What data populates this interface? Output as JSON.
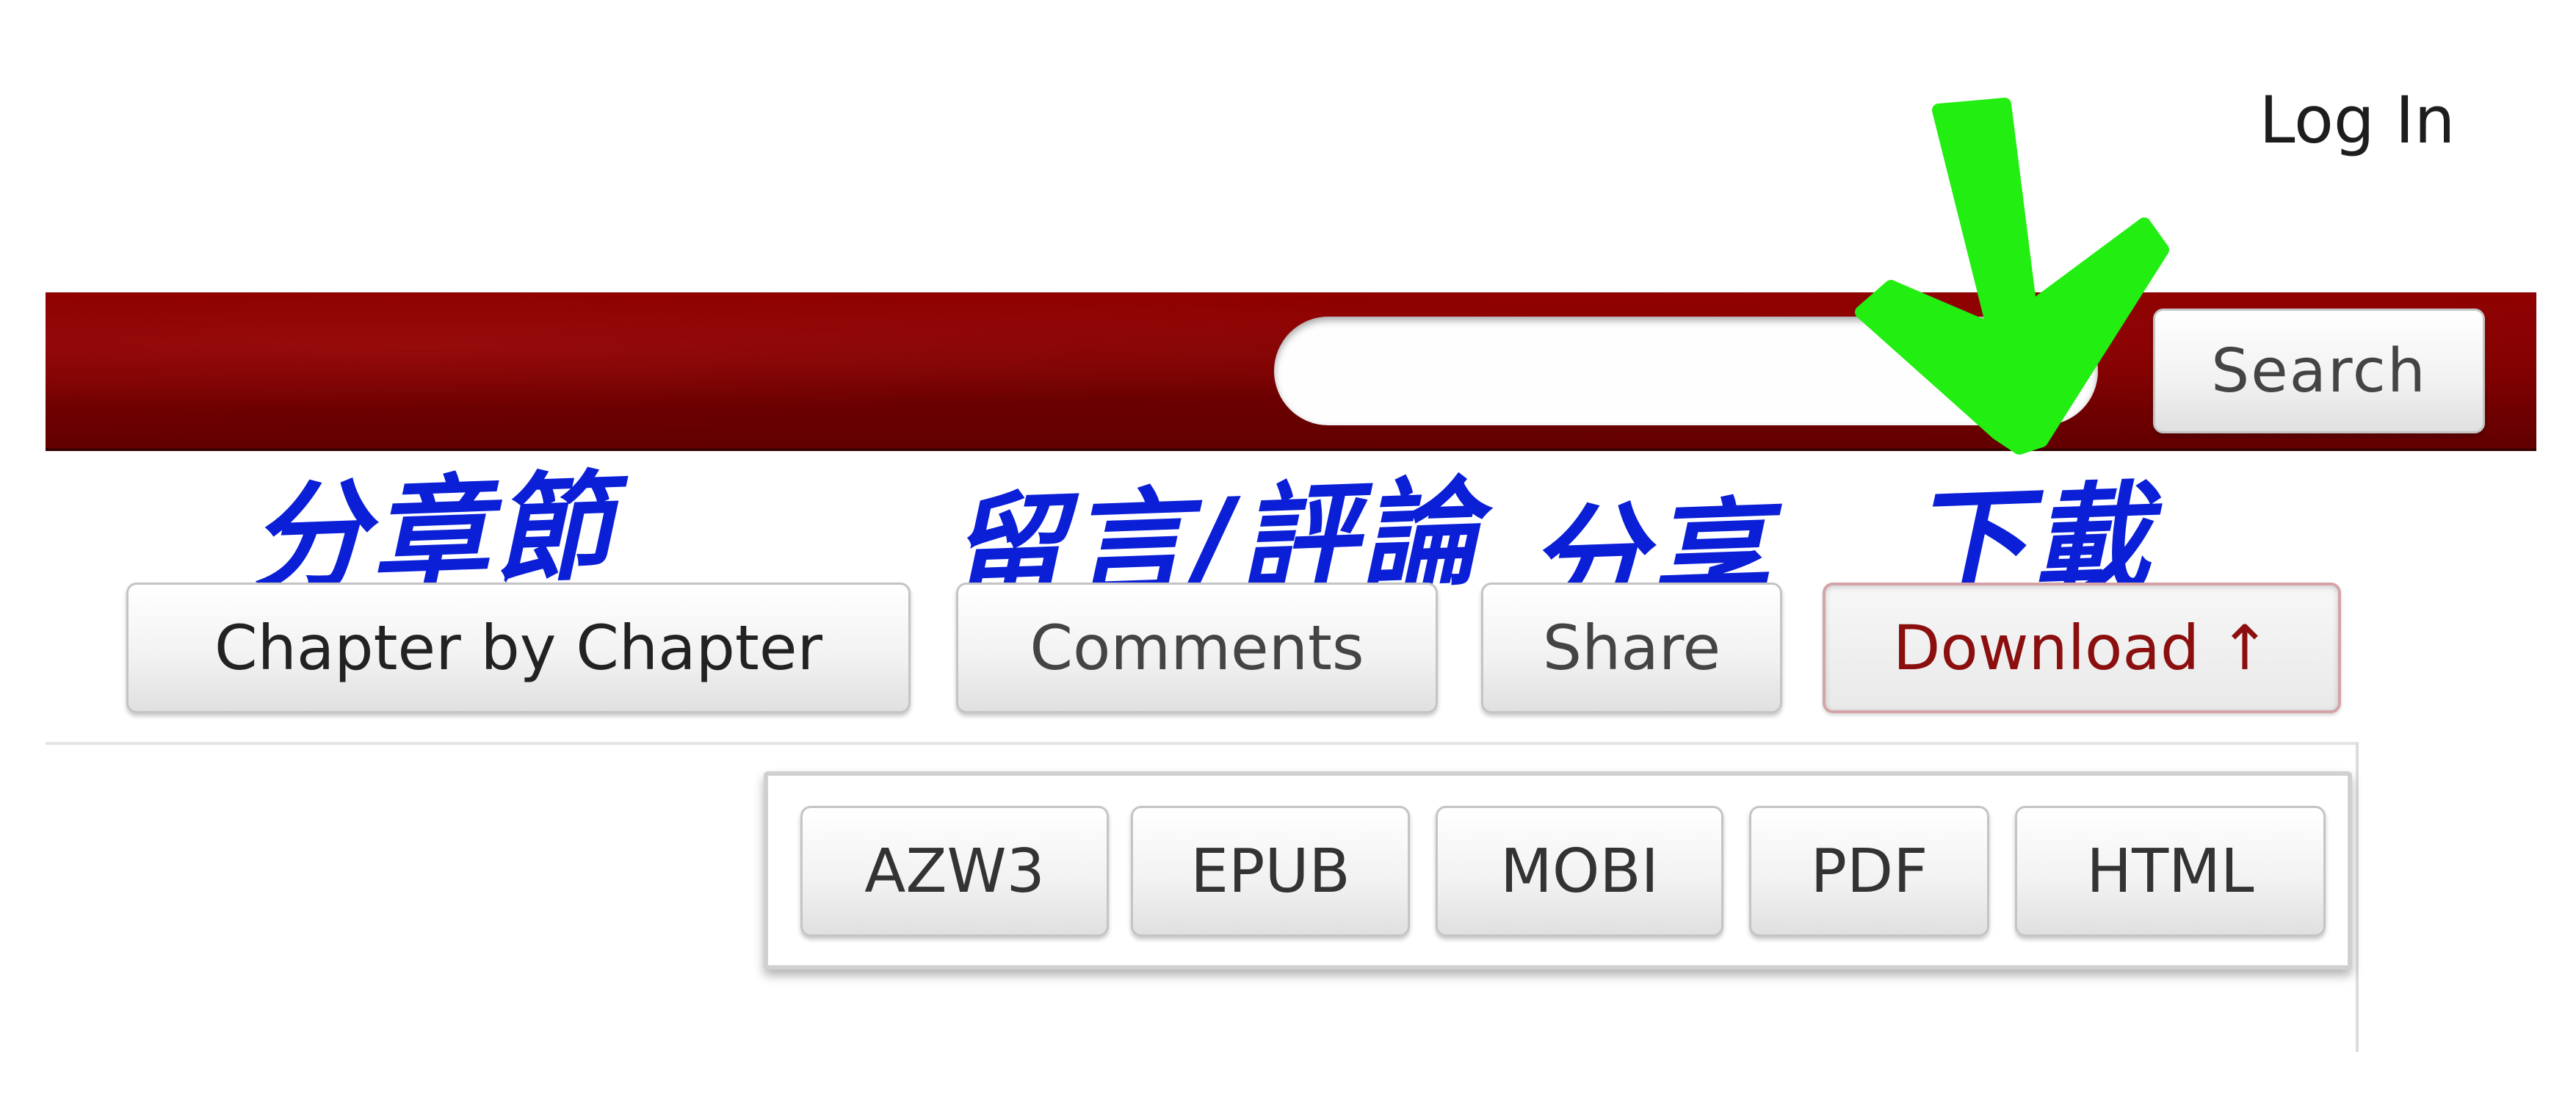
{
  "header": {
    "login_label": "Log In"
  },
  "search": {
    "placeholder": "",
    "button_label": "Search"
  },
  "tabs": [
    {
      "label": "Chapter by Chapter"
    },
    {
      "label": "Comments"
    },
    {
      "label": "Share"
    },
    {
      "label": "Download ↑",
      "active": true
    }
  ],
  "download_formats": [
    "AZW3",
    "EPUB",
    "MOBI",
    "PDF",
    "HTML"
  ],
  "annotations": {
    "chapter": "分章節",
    "comments": "留言/評論",
    "share": "分享",
    "download": "下載",
    "arrow_icon": "down-arrow-icon",
    "handwriting_color": "#0a1fd6",
    "arrow_color": "#22ee11"
  },
  "colors": {
    "brand_bar": "#8e0000",
    "active_tab_text": "#8c0f0f"
  }
}
